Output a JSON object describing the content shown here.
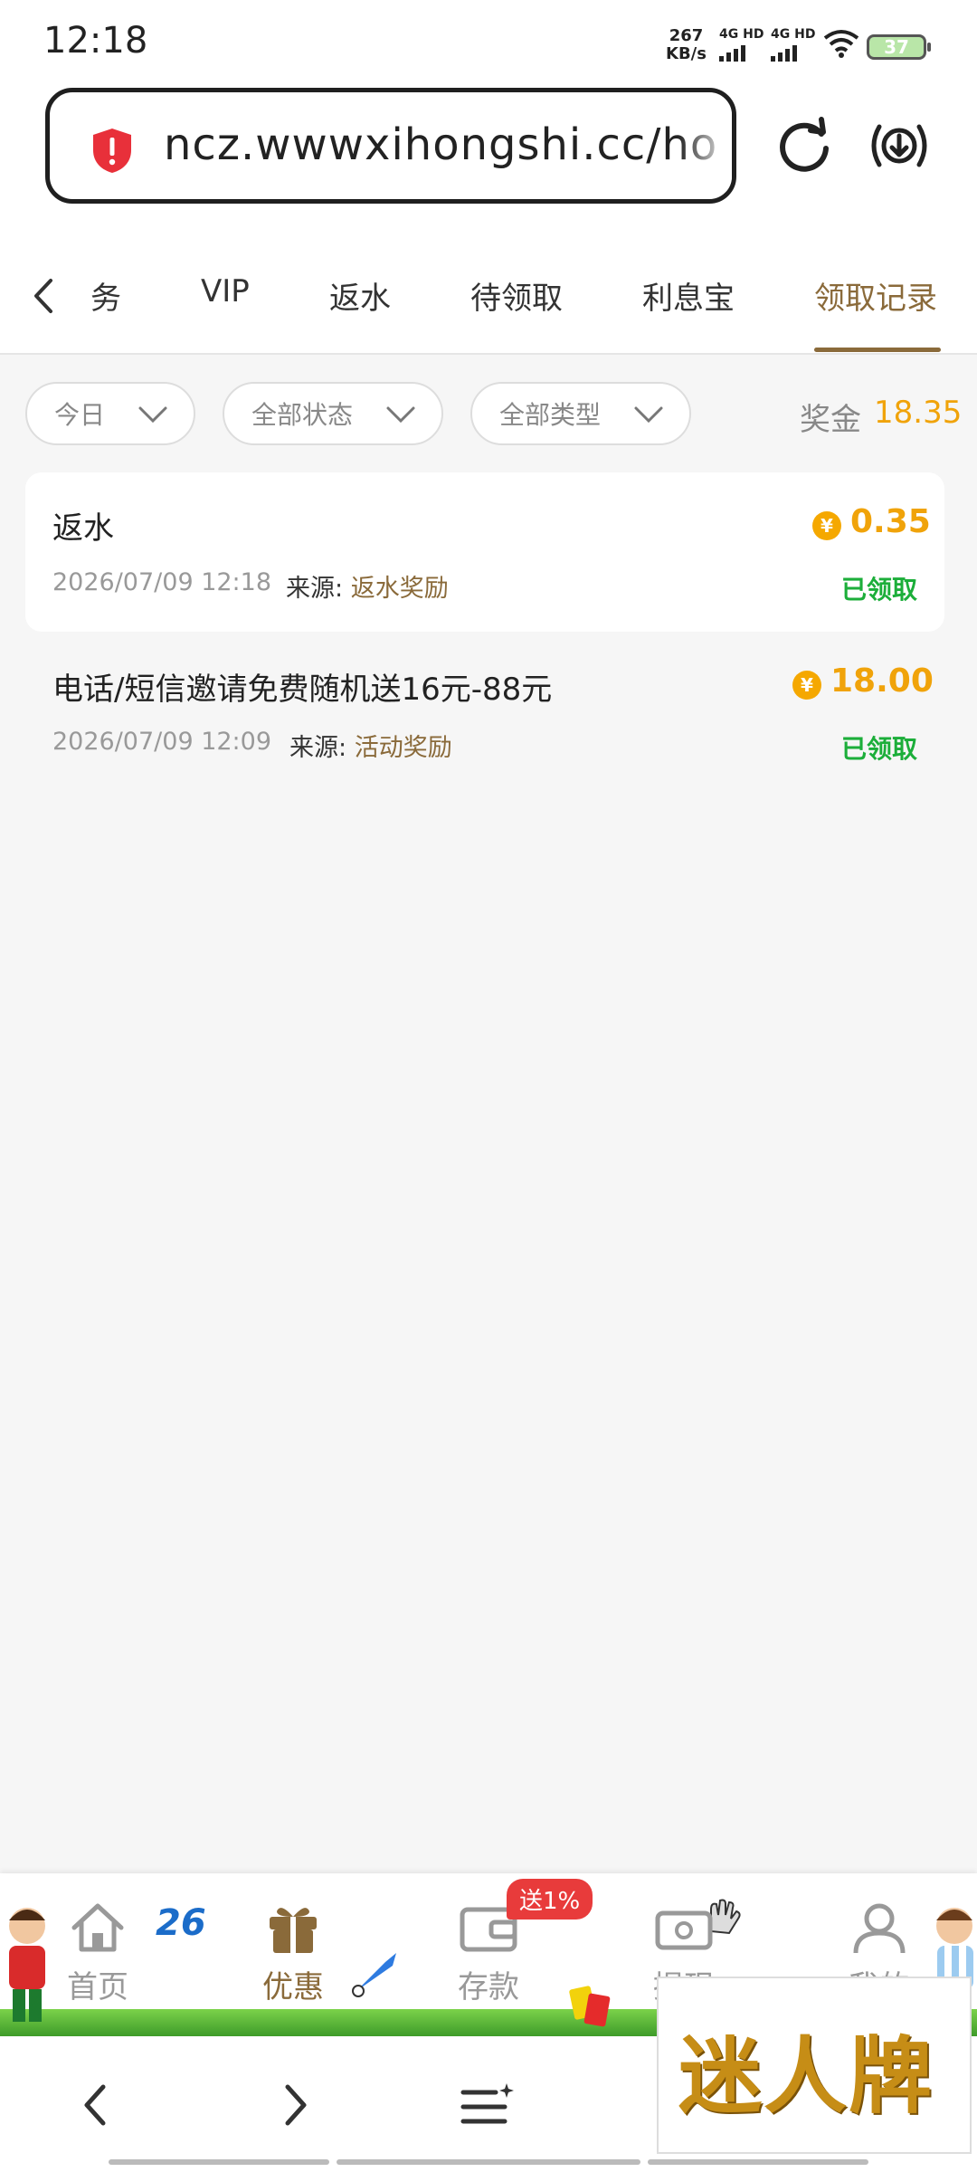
{
  "status_bar": {
    "time": "12:18",
    "net_speed": "267",
    "net_unit": "KB/s",
    "sim1": "4G HD",
    "sim2": "4G HD",
    "battery": "37"
  },
  "url_bar": {
    "url": "ncz.wwwxihongshi.cc/ho"
  },
  "tabs": [
    {
      "label": "务"
    },
    {
      "label": "VIP"
    },
    {
      "label": "返水"
    },
    {
      "label": "待领取"
    },
    {
      "label": "利息宝"
    },
    {
      "label": "领取记录"
    }
  ],
  "filters": {
    "date": "今日",
    "status": "全部状态",
    "type": "全部类型"
  },
  "bonus": {
    "label": "奖金",
    "value": "18.35"
  },
  "records": [
    {
      "title": "返水",
      "datetime": "2026/07/09 12:18",
      "source_label": "来源:",
      "source": "返水奖励",
      "amount": "0.35",
      "status": "已领取"
    },
    {
      "title": "电话/短信邀请免费随机送16元-88元",
      "datetime": "2026/07/09 12:09",
      "source_label": "来源:",
      "source": "活动奖励",
      "amount": "18.00",
      "status": "已领取"
    }
  ],
  "bottom_nav": [
    {
      "label": "首页",
      "icon": "home-icon"
    },
    {
      "label": "优惠",
      "icon": "gift-icon"
    },
    {
      "label": "存款",
      "icon": "wallet-icon"
    },
    {
      "label": "提现",
      "icon": "cash-icon"
    },
    {
      "label": "我的",
      "icon": "user-icon"
    }
  ],
  "deposit_badge": "送1%",
  "watermark": "迷人牌",
  "colors": {
    "accent": "#8a6a3a",
    "gold": "#f0a30a",
    "success": "#1cae3a"
  }
}
